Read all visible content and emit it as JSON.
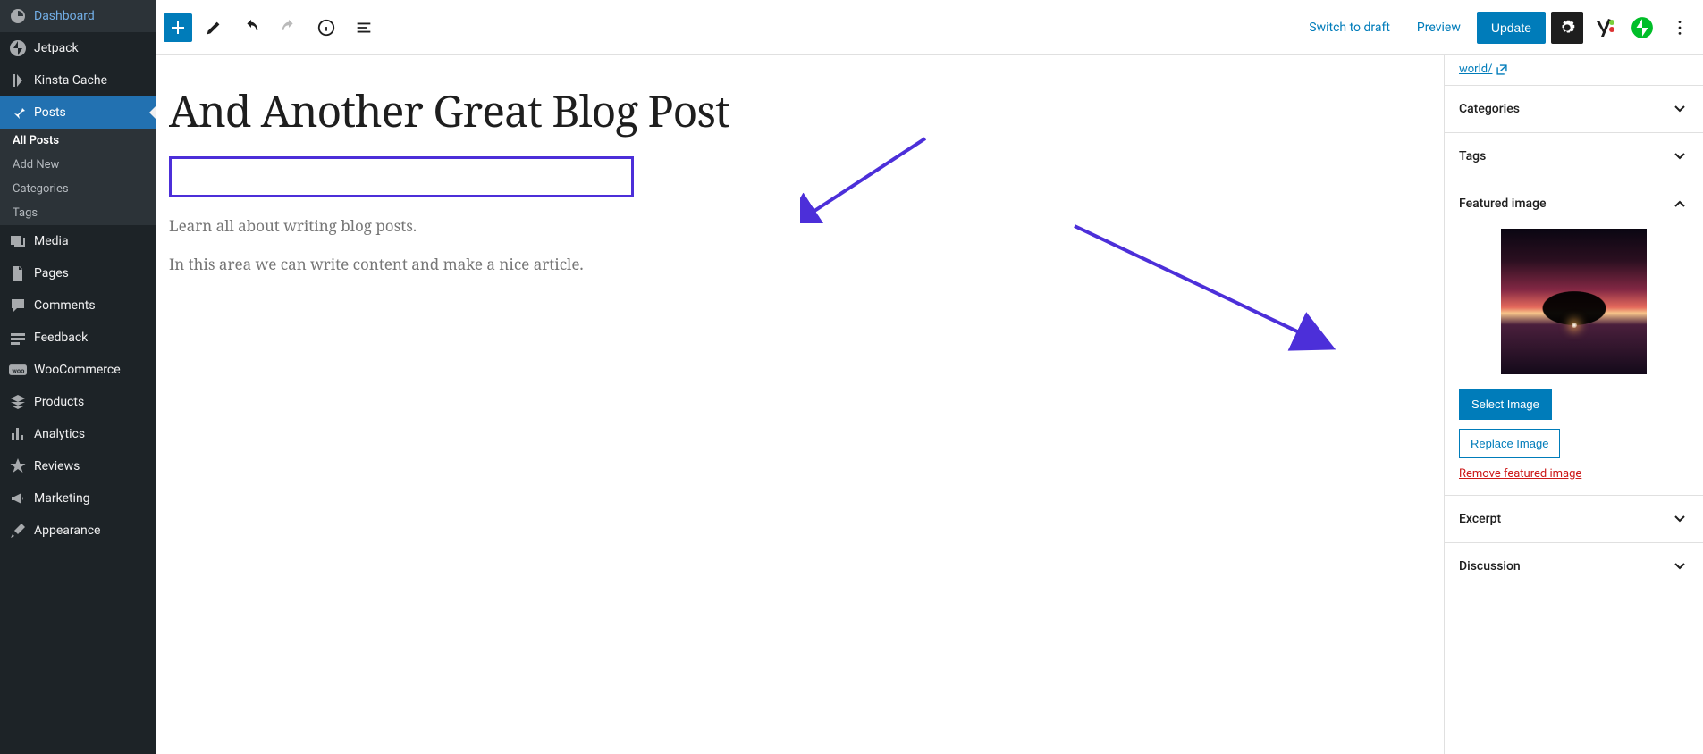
{
  "sidebar": {
    "items": [
      {
        "label": "Dashboard",
        "icon": "dashboard"
      },
      {
        "label": "Jetpack",
        "icon": "jetpack"
      },
      {
        "label": "Kinsta Cache",
        "icon": "kinsta"
      },
      {
        "label": "Posts",
        "icon": "pin",
        "active": true
      },
      {
        "label": "Media",
        "icon": "media"
      },
      {
        "label": "Pages",
        "icon": "pages"
      },
      {
        "label": "Comments",
        "icon": "comments"
      },
      {
        "label": "Feedback",
        "icon": "feedback"
      },
      {
        "label": "WooCommerce",
        "icon": "woo"
      },
      {
        "label": "Products",
        "icon": "products"
      },
      {
        "label": "Analytics",
        "icon": "analytics"
      },
      {
        "label": "Reviews",
        "icon": "star"
      },
      {
        "label": "Marketing",
        "icon": "megaphone"
      },
      {
        "label": "Appearance",
        "icon": "brush"
      }
    ],
    "sub": [
      {
        "label": "All Posts",
        "current": true
      },
      {
        "label": "Add New"
      },
      {
        "label": "Categories"
      },
      {
        "label": "Tags"
      }
    ]
  },
  "toolbar": {
    "switch_draft": "Switch to draft",
    "preview": "Preview",
    "update": "Update"
  },
  "post": {
    "title": "And Another Great Blog Post",
    "blocks": [
      "Learn all about writing blog posts.",
      "In this area we can write content and make a nice article."
    ]
  },
  "panel": {
    "permalink_text": "world/",
    "sections": {
      "categories": "Categories",
      "tags": "Tags",
      "featured_image": "Featured image",
      "excerpt": "Excerpt",
      "discussion": "Discussion"
    },
    "featured": {
      "select": "Select Image",
      "replace": "Replace Image",
      "remove": "Remove featured image"
    }
  }
}
